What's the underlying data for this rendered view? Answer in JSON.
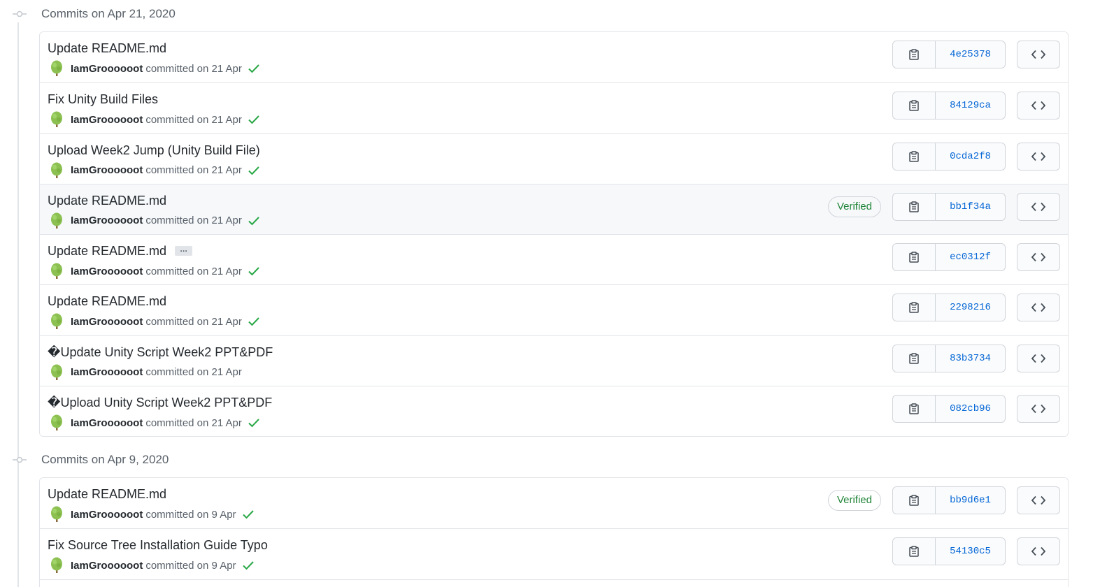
{
  "groups": [
    {
      "title": "Commits on Apr 21, 2020",
      "commits": [
        {
          "title": "Update README.md",
          "author": "IamGroooooot",
          "action": "committed on 21 Apr",
          "sha": "4e25378",
          "verified": false,
          "check": true,
          "ellipsis": false
        },
        {
          "title": "Fix Unity Build Files",
          "author": "IamGroooooot",
          "action": "committed on 21 Apr",
          "sha": "84129ca",
          "verified": false,
          "check": true,
          "ellipsis": false
        },
        {
          "title": "Upload Week2 Jump (Unity Build File)",
          "author": "IamGroooooot",
          "action": "committed on 21 Apr",
          "sha": "0cda2f8",
          "verified": false,
          "check": true,
          "ellipsis": false
        },
        {
          "title": "Update README.md",
          "author": "IamGroooooot",
          "action": "committed on 21 Apr",
          "sha": "bb1f34a",
          "verified": true,
          "check": true,
          "ellipsis": false,
          "highlight": true
        },
        {
          "title": "Update README.md",
          "author": "IamGroooooot",
          "action": "committed on 21 Apr",
          "sha": "ec0312f",
          "verified": false,
          "check": true,
          "ellipsis": true
        },
        {
          "title": "Update README.md",
          "author": "IamGroooooot",
          "action": "committed on 21 Apr",
          "sha": "2298216",
          "verified": false,
          "check": true,
          "ellipsis": false
        },
        {
          "title": "�Update Unity Script Week2 PPT&PDF",
          "author": "IamGroooooot",
          "action": "committed on 21 Apr",
          "sha": "83b3734",
          "verified": false,
          "check": false,
          "ellipsis": false
        },
        {
          "title": "�Upload Unity Script Week2 PPT&PDF",
          "author": "IamGroooooot",
          "action": "committed on 21 Apr",
          "sha": "082cb96",
          "verified": false,
          "check": true,
          "ellipsis": false
        }
      ]
    },
    {
      "title": "Commits on Apr 9, 2020",
      "commits": [
        {
          "title": "Update README.md",
          "author": "IamGroooooot",
          "action": "committed on 9 Apr",
          "sha": "bb9d6e1",
          "verified": true,
          "check": true,
          "ellipsis": false
        },
        {
          "title": "Fix Source Tree Installation Guide Typo",
          "author": "IamGroooooot",
          "action": "committed on 9 Apr",
          "sha": "54130c5",
          "verified": false,
          "check": true,
          "ellipsis": false
        },
        {
          "title": "",
          "author": "",
          "action": "",
          "sha": "",
          "verified": false,
          "check": false,
          "ellipsis": false,
          "partial": true
        }
      ]
    }
  ],
  "labels": {
    "verified": "Verified",
    "ellipsis": "…"
  },
  "icons": {
    "copy": "clipboard-icon",
    "browse": "code-icon",
    "check": "check-icon",
    "avatar": "tree-avatar",
    "node": "git-commit-icon"
  },
  "colors": {
    "link": "#0366d6",
    "success": "#22863a",
    "muted": "#586069",
    "border": "#e1e4e8"
  }
}
